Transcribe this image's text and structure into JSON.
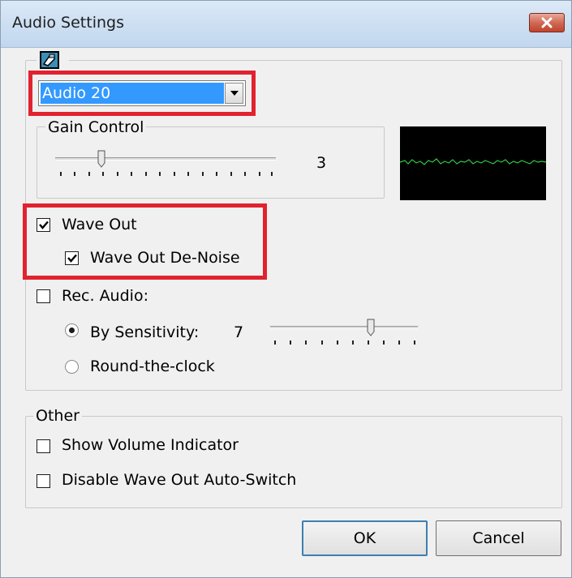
{
  "window": {
    "title": "Audio Settings"
  },
  "audio_source": {
    "selected": "Audio 20"
  },
  "gain_control": {
    "label": "Gain Control",
    "value": "3",
    "level": 0.2
  },
  "wave_out": {
    "label": "Wave Out",
    "checked": true
  },
  "wave_out_denoise": {
    "label": "Wave Out De-Noise",
    "checked": true
  },
  "rec_audio": {
    "label": "Rec. Audio:",
    "checked": false,
    "by_sensitivity": {
      "label": "By Sensitivity:",
      "value": "7",
      "level": 0.7,
      "selected": true
    },
    "round_the_clock": {
      "label": "Round-the-clock",
      "selected": false
    }
  },
  "other": {
    "label": "Other",
    "show_volume_indicator": {
      "label": "Show Volume Indicator",
      "checked": false
    },
    "disable_auto_switch": {
      "label": "Disable Wave Out Auto-Switch",
      "checked": false
    }
  },
  "buttons": {
    "ok": "OK",
    "cancel": "Cancel"
  },
  "colors": {
    "highlight_red": "#e2222f",
    "selection_blue": "#3399ff",
    "scope_wave": "#2ecc40"
  }
}
